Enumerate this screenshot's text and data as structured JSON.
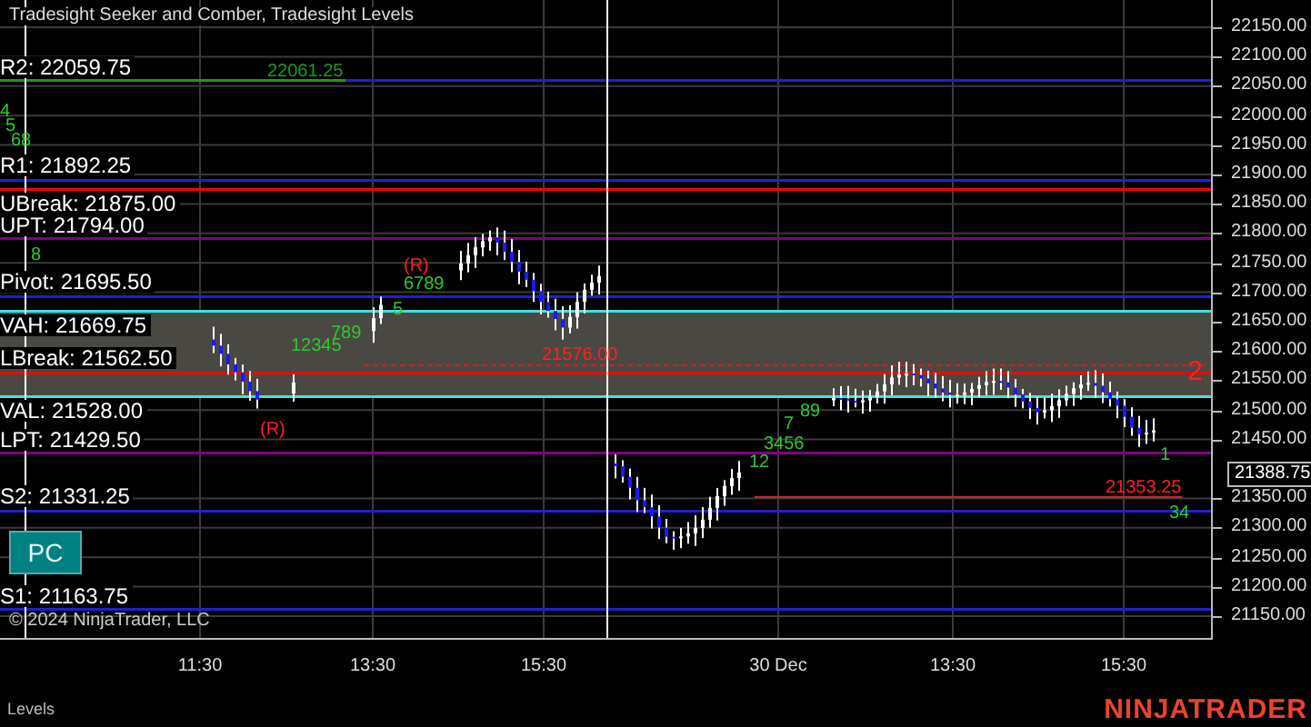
{
  "chart": {
    "title": "Tradesight Seeker and Comber, Tradesight Levels",
    "levels": [
      {
        "label": "R2: 22059.75",
        "color": "#2020d0"
      },
      {
        "label": "R1: 21892.25",
        "color": "#2020d0"
      },
      {
        "label": "UBreak: 21875.00",
        "color": "#ff0000"
      },
      {
        "label": "UPT: 21794.00",
        "color": "#800080"
      },
      {
        "label": "Pivot: 21695.50",
        "color": "#2020d0"
      },
      {
        "label": "VAH: 21669.75",
        "color": "#40e0e0"
      },
      {
        "label": "LBreak: 21562.50",
        "color": "#ff0000"
      },
      {
        "label": "VAL: 21528.00",
        "color": "#40e0e0"
      },
      {
        "label": "LPT: 21429.50",
        "color": "#800080"
      },
      {
        "label": "S2: 21331.25",
        "color": "#2020d0"
      },
      {
        "label": "S1: 21163.75",
        "color": "#2020d0"
      }
    ],
    "markers": [
      {
        "kind": "price",
        "text": "22061.25"
      },
      {
        "kind": "price",
        "text": "21576.00"
      },
      {
        "kind": "price",
        "text": "21353.25"
      },
      {
        "kind": "reversal",
        "text": "(R)"
      },
      {
        "kind": "reversal",
        "text": "(R)"
      },
      {
        "kind": "count",
        "text": "2"
      },
      {
        "kind": "step",
        "text": "4"
      },
      {
        "kind": "step",
        "text": "5"
      },
      {
        "kind": "step",
        "text": "68"
      },
      {
        "kind": "step",
        "text": "8"
      },
      {
        "kind": "step",
        "text": "12345"
      },
      {
        "kind": "step",
        "text": "789"
      },
      {
        "kind": "step",
        "text": "5"
      },
      {
        "kind": "step",
        "text": "6789"
      },
      {
        "kind": "step",
        "text": "12"
      },
      {
        "kind": "step",
        "text": "3456"
      },
      {
        "kind": "step",
        "text": "7"
      },
      {
        "kind": "step",
        "text": "89"
      },
      {
        "kind": "step",
        "text": "1"
      },
      {
        "kind": "step",
        "text": "34"
      }
    ],
    "button": "PC",
    "copyright": "© 2024 NinjaTrader, LLC",
    "price_axis": [
      "22150.00",
      "22100.00",
      "22050.00",
      "22000.00",
      "21950.00",
      "21900.00",
      "21850.00",
      "21800.00",
      "21750.00",
      "21700.00",
      "21650.00",
      "21600.00",
      "21550.00",
      "21500.00",
      "21450.00",
      "21350.00",
      "21300.00",
      "21250.00",
      "21200.00",
      "21150.00"
    ],
    "current_price": "21388.75",
    "time_axis": [
      "11:30",
      "13:30",
      "15:30",
      "30 Dec",
      "13:30",
      "15:30"
    ]
  },
  "tab": "Levels",
  "logo": "NINJATRADER"
}
